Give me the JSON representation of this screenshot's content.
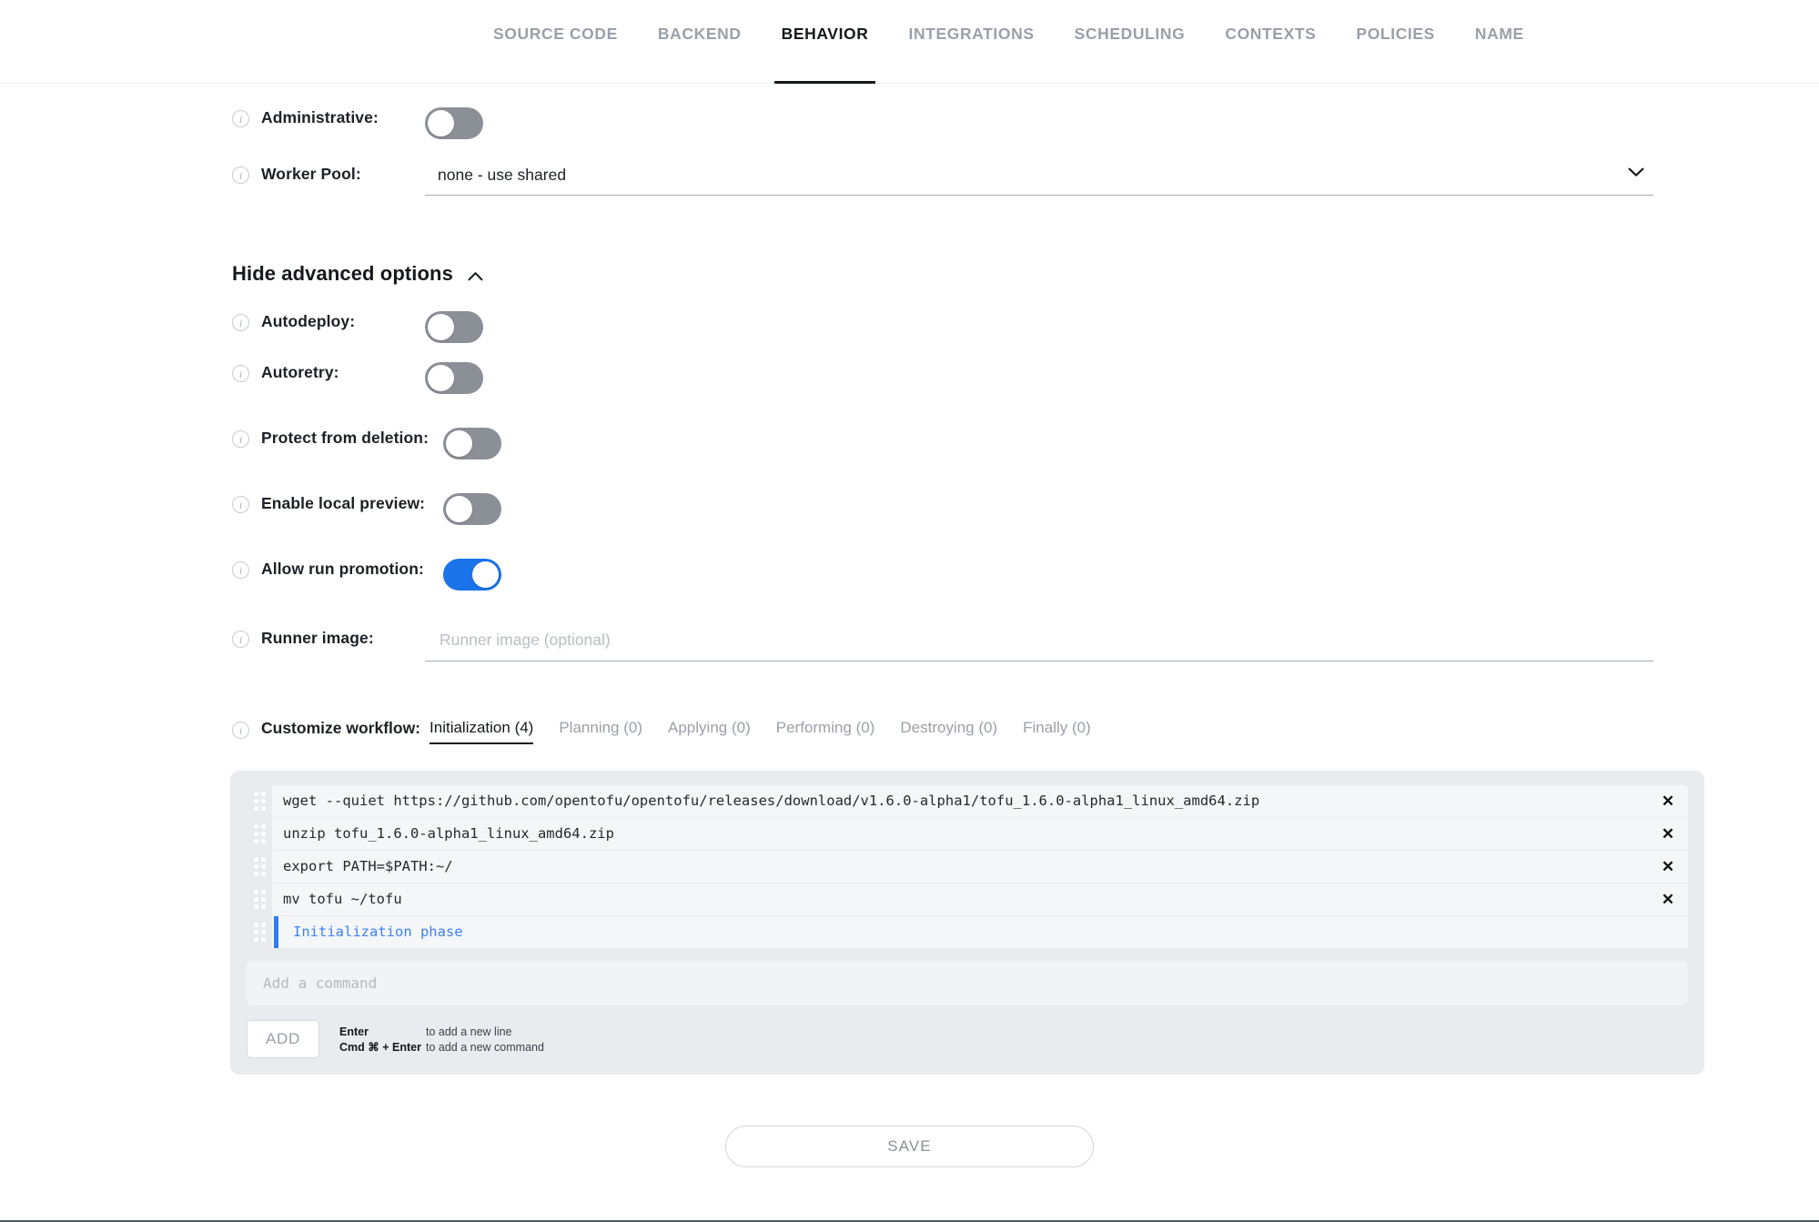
{
  "tabs": [
    {
      "label": "SOURCE CODE",
      "active": false
    },
    {
      "label": "BACKEND",
      "active": false
    },
    {
      "label": "BEHAVIOR",
      "active": true
    },
    {
      "label": "INTEGRATIONS",
      "active": false
    },
    {
      "label": "SCHEDULING",
      "active": false
    },
    {
      "label": "CONTEXTS",
      "active": false
    },
    {
      "label": "POLICIES",
      "active": false
    },
    {
      "label": "NAME",
      "active": false
    }
  ],
  "form": {
    "administrative": {
      "label": "Administrative:",
      "state": "off"
    },
    "worker_pool": {
      "label": "Worker Pool:",
      "value": "none - use shared"
    },
    "advanced_toggle": {
      "label": "Hide advanced options"
    },
    "autodeploy": {
      "label": "Autodeploy:",
      "state": "off"
    },
    "autoretry": {
      "label": "Autoretry:",
      "state": "off"
    },
    "protect_from_deletion": {
      "label": "Protect from deletion:",
      "state": "off"
    },
    "enable_local_preview": {
      "label": "Enable local preview:",
      "state": "off"
    },
    "allow_run_promotion": {
      "label": "Allow run promotion:",
      "state": "on"
    },
    "runner_image": {
      "label": "Runner image:",
      "value": "",
      "placeholder": "Runner image (optional)"
    },
    "customize_workflow": {
      "label": "Customize workflow:"
    }
  },
  "workflow_tabs": [
    {
      "label": "Initialization (4)",
      "active": true
    },
    {
      "label": "Planning (0)",
      "active": false
    },
    {
      "label": "Applying (0)",
      "active": false
    },
    {
      "label": "Performing (0)",
      "active": false
    },
    {
      "label": "Destroying (0)",
      "active": false
    },
    {
      "label": "Finally (0)",
      "active": false
    }
  ],
  "commands": [
    {
      "text": "wget --quiet https://github.com/opentofu/opentofu/releases/download/v1.6.0-alpha1/tofu_1.6.0-alpha1_linux_amd64.zip",
      "deletable": true
    },
    {
      "text": "unzip tofu_1.6.0-alpha1_linux_amd64.zip",
      "deletable": true
    },
    {
      "text": "export PATH=$PATH:~/",
      "deletable": true
    },
    {
      "text": "mv tofu ~/tofu",
      "deletable": true
    }
  ],
  "phase_row": {
    "text": "Initialization phase"
  },
  "command_input": {
    "value": "",
    "placeholder": "Add a command"
  },
  "add_button": {
    "label": "ADD"
  },
  "hints": [
    {
      "key": "Enter",
      "desc": "to add a new line"
    },
    {
      "key": "Cmd ⌘ + Enter",
      "desc": "to add a new command"
    }
  ],
  "save_button": {
    "label": "SAVE"
  },
  "colors": {
    "accent_blue": "#1a73e8",
    "phase_blue": "#3b82f6",
    "toggle_off": "#8b9097",
    "panel_bg": "#e9ebee",
    "muted_text": "#9aa0a9"
  },
  "icons": {
    "info": "info-icon",
    "chevron_down": "chevron-down-icon",
    "chevron_up": "chevron-up-icon",
    "drag": "drag-handle-icon",
    "close": "close-icon"
  }
}
